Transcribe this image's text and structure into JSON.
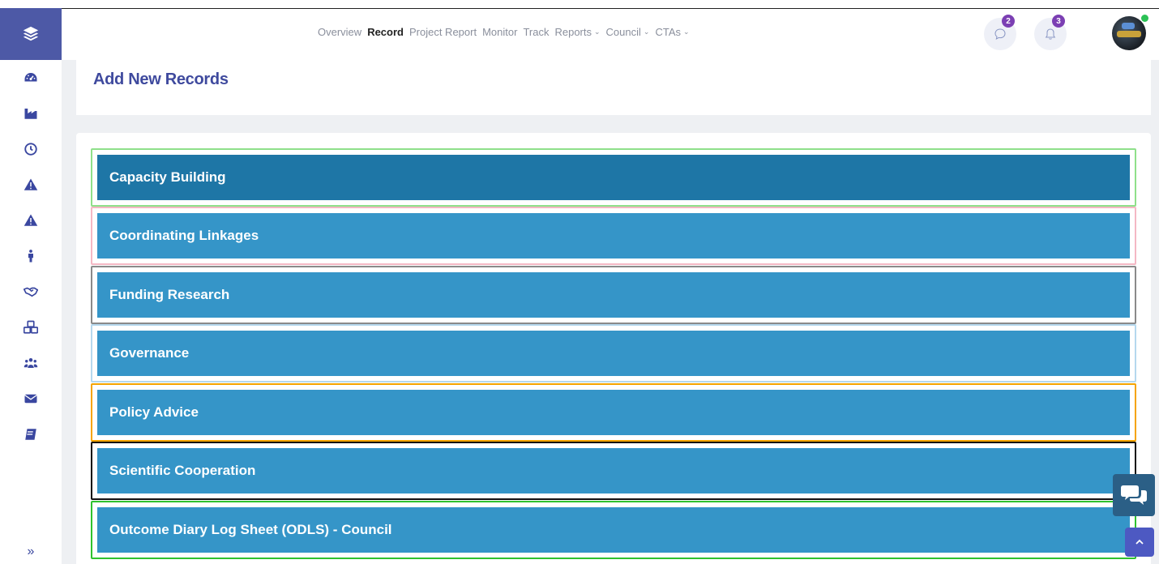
{
  "nav": {
    "items": [
      {
        "label": "Overview",
        "active": false,
        "dropdown": false
      },
      {
        "label": "Record",
        "active": true,
        "dropdown": false
      },
      {
        "label": "Project Report",
        "active": false,
        "dropdown": false
      },
      {
        "label": "Monitor",
        "active": false,
        "dropdown": false
      },
      {
        "label": "Track",
        "active": false,
        "dropdown": false
      },
      {
        "label": "Reports",
        "active": false,
        "dropdown": true
      },
      {
        "label": "Council",
        "active": false,
        "dropdown": true
      },
      {
        "label": "CTAs",
        "active": false,
        "dropdown": true
      }
    ]
  },
  "header_actions": {
    "messages_badge": "2",
    "notifications_badge": "3"
  },
  "sidebar": {
    "icons": [
      "dashboard-icon",
      "factory-icon",
      "clock-icon",
      "warning-icon",
      "warning-icon",
      "person-icon",
      "handshake-icon",
      "boxes-icon",
      "users-icon",
      "envelope-icon",
      "book-icon"
    ],
    "expand_label": "»"
  },
  "page": {
    "title": "Add New Records"
  },
  "records": [
    {
      "label": "Capacity Building",
      "border_color": "#8fe08a",
      "bar_color": "#1e76a6"
    },
    {
      "label": "Coordinating Linkages",
      "border_color": "#f4b8c4",
      "bar_color": "#3595c8"
    },
    {
      "label": "Funding Research",
      "border_color": "#8a8a8a",
      "bar_color": "#3595c8"
    },
    {
      "label": "Governance",
      "border_color": "#b5d8ee",
      "bar_color": "#3595c8"
    },
    {
      "label": "Policy Advice",
      "border_color": "#f5a400",
      "bar_color": "#3595c8"
    },
    {
      "label": "Scientific Cooperation",
      "border_color": "#111111",
      "bar_color": "#3595c8"
    },
    {
      "label": "Outcome Diary Log Sheet (ODLS) - Council",
      "border_color": "#2fc22f",
      "bar_color": "#3595c8"
    }
  ],
  "colors": {
    "brand": "#4d59a6",
    "title": "#3f4a9e",
    "sidebar_icon": "#3a47a0"
  }
}
